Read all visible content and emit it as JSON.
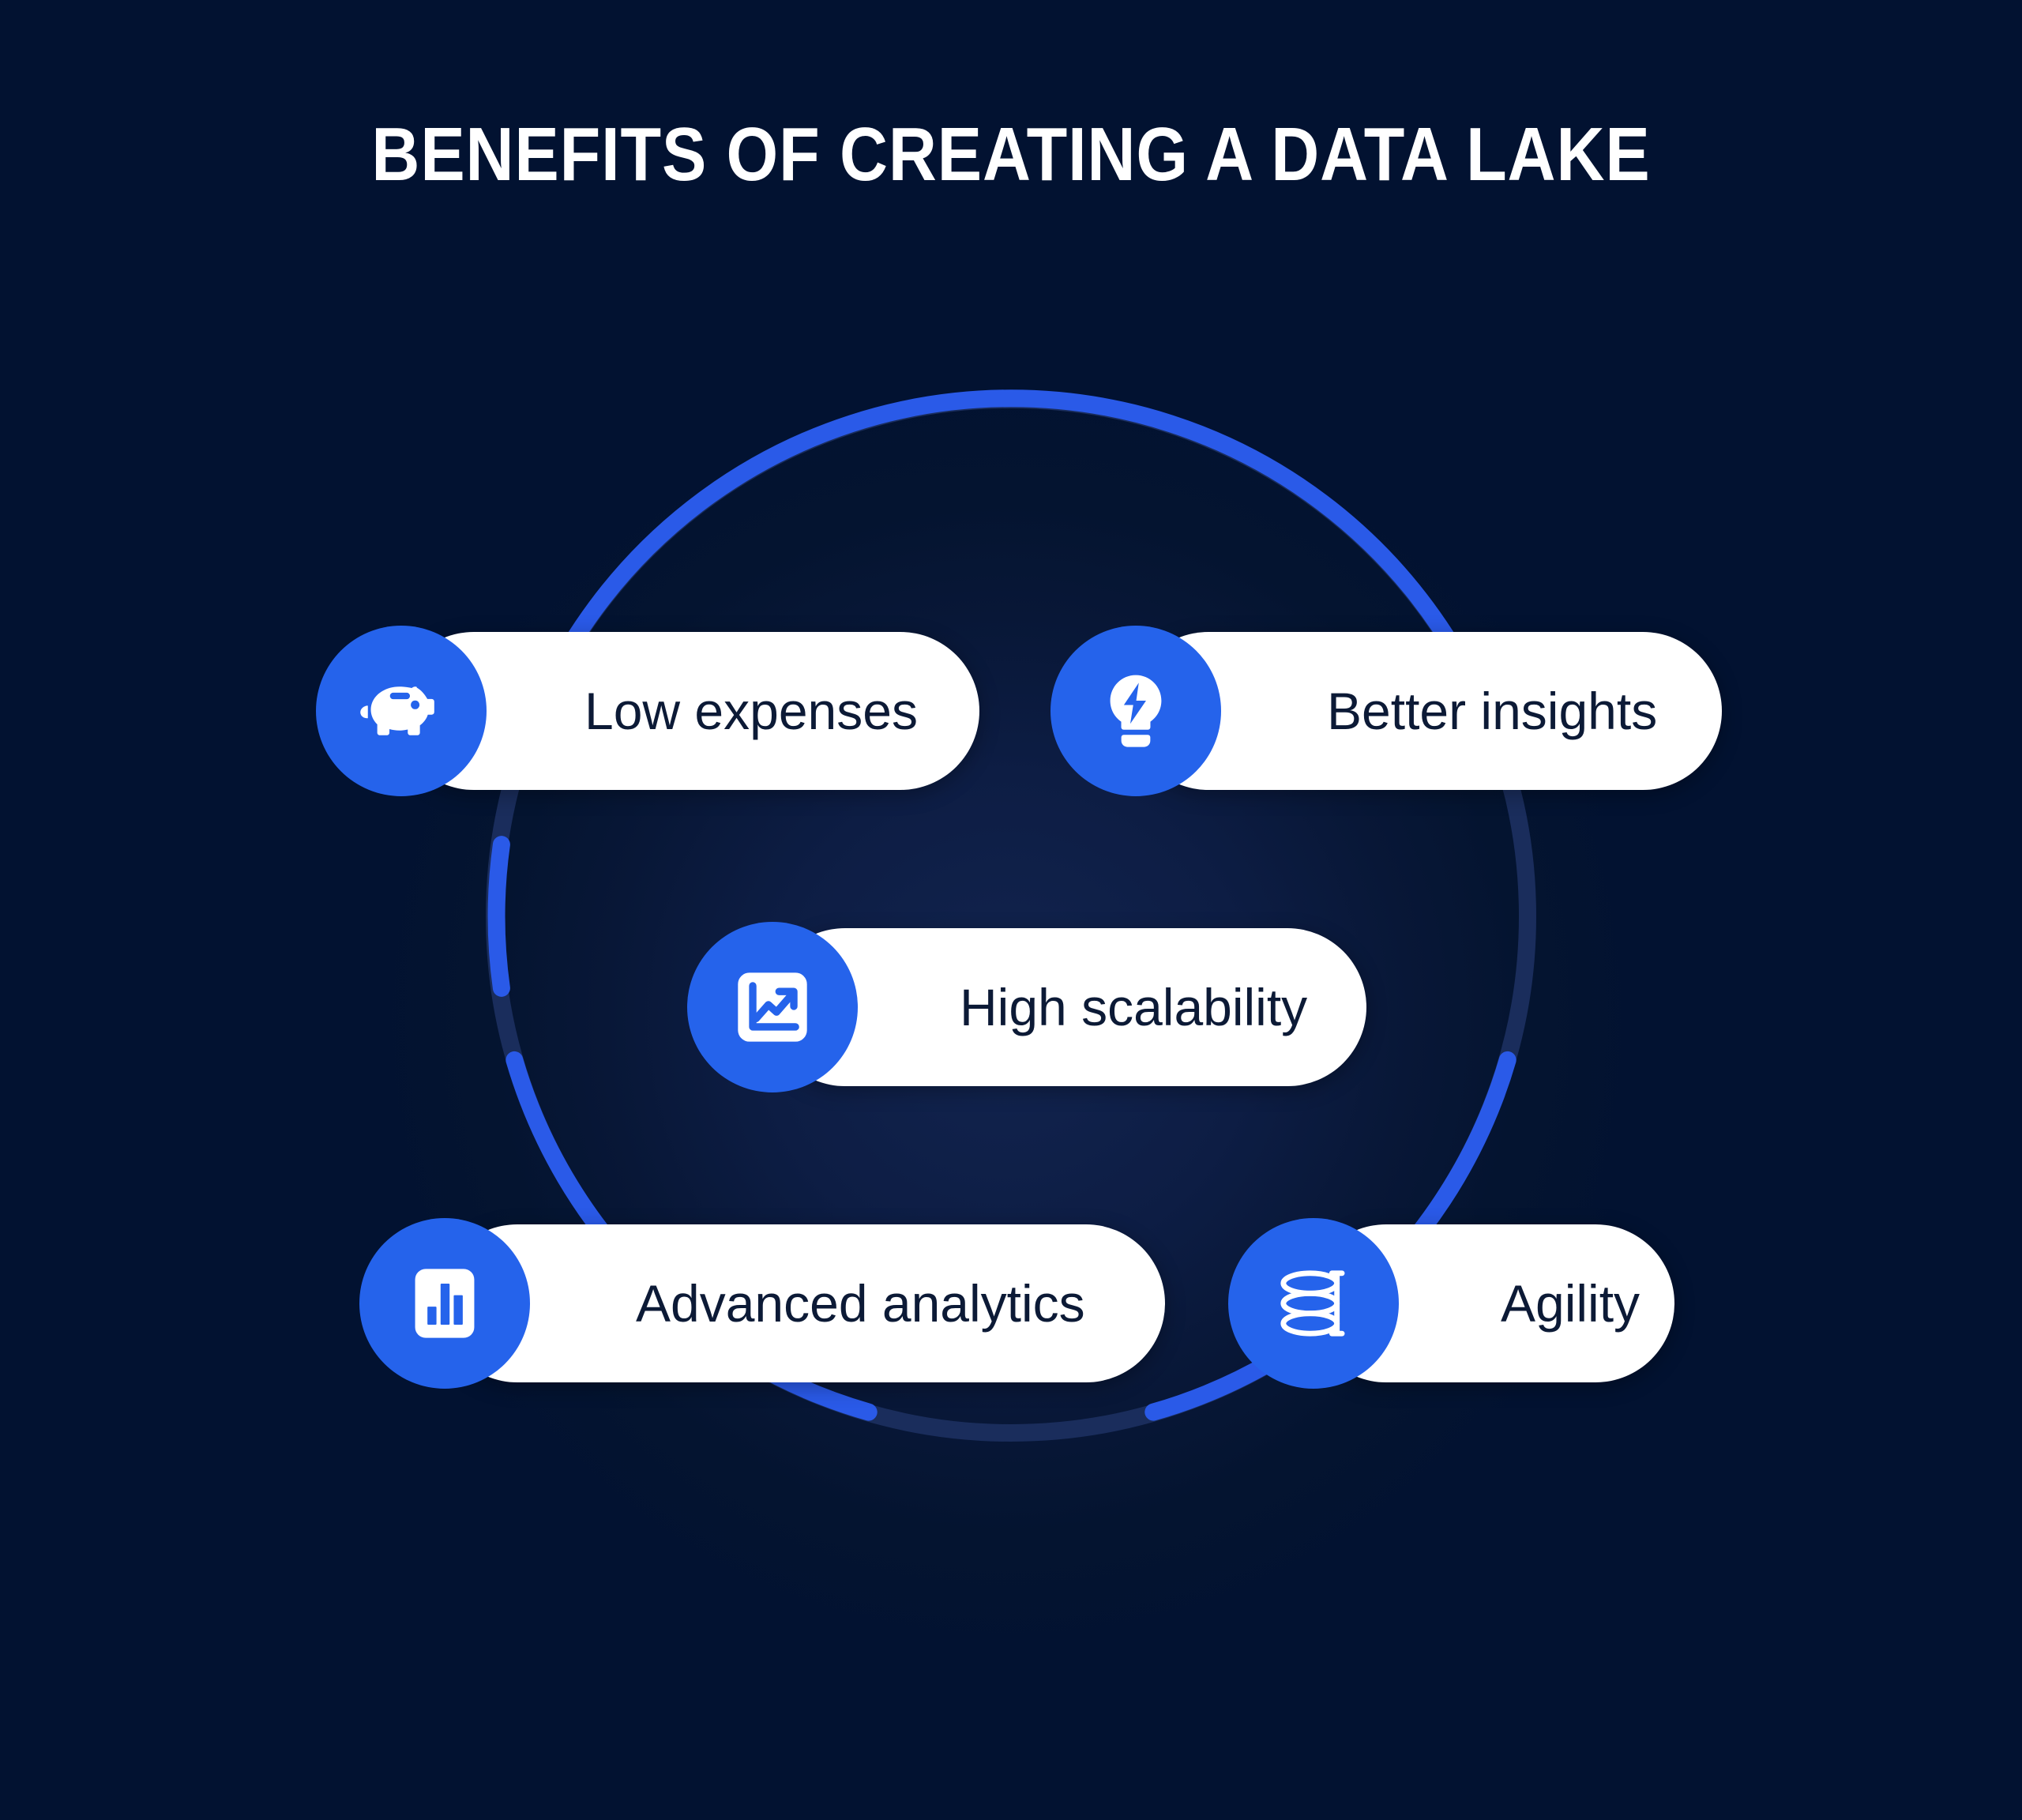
{
  "title": "BENEFITS OF CREATING A DATA LAKE",
  "colors": {
    "background_dark": "#021231",
    "background_glow": "#12244f",
    "accent_blue": "#2563eb",
    "ring_base": "#1a2d5c",
    "pill_background": "#ffffff",
    "pill_text": "#0c1a36",
    "title_text": "#ffffff"
  },
  "ring": {
    "segment_count": 4,
    "base_color": "#1a2d5c",
    "segment_color": "#2a5ae8"
  },
  "benefits": [
    {
      "id": "low-expenses",
      "label": "Low expenses",
      "icon": "piggy-bank-icon"
    },
    {
      "id": "better-insights",
      "label": "Better insights",
      "icon": "lightbulb-bolt-icon"
    },
    {
      "id": "high-scalability",
      "label": "High scalability",
      "icon": "trending-up-chart-icon"
    },
    {
      "id": "advanced-analytics",
      "label": "Advanced analytics",
      "icon": "bar-chart-icon"
    },
    {
      "id": "agility",
      "label": "Agility",
      "icon": "spring-coil-icon"
    }
  ]
}
